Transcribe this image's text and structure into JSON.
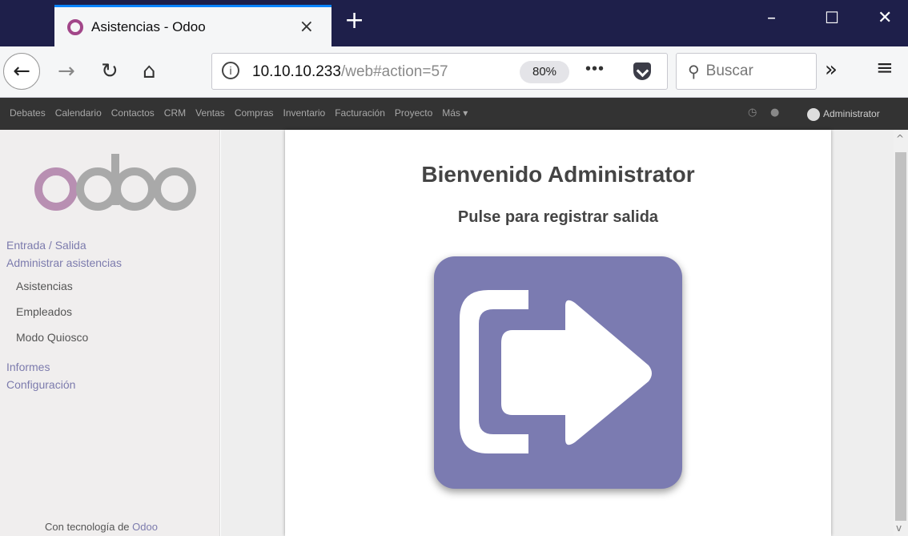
{
  "browser": {
    "tab_title": "Asistencias - Odoo",
    "tab_close": "×",
    "new_tab": "+",
    "window_controls": {
      "minimize": "–",
      "maximize": "☐",
      "close": "✕"
    },
    "nav": {
      "back": "←",
      "forward": "→",
      "reload": "↻",
      "home": "⌂"
    },
    "url_host": "10.10.10.233",
    "url_path": "/web#action=57",
    "zoom": "80%",
    "more_actions": "•••",
    "search_placeholder": "Buscar",
    "overflow": "»",
    "menu": "≡"
  },
  "odoo_topbar": {
    "apps": [
      "Debates",
      "Calendario",
      "Contactos",
      "CRM",
      "Ventas",
      "Compras",
      "Inventario",
      "Facturación",
      "Proyecto",
      "Más ▾"
    ],
    "user": "Administrator",
    "icons": [
      "clock-icon",
      "chat-icon"
    ]
  },
  "sidebar": {
    "logo_text": "odoo",
    "sections": [
      {
        "label": "Entrada / Salida"
      },
      {
        "label": "Administrar asistencias"
      }
    ],
    "items": [
      {
        "label": "Asistencias"
      },
      {
        "label": "Empleados"
      },
      {
        "label": "Modo Quiosco"
      }
    ],
    "sections_bottom": [
      {
        "label": "Informes"
      },
      {
        "label": "Configuración"
      }
    ],
    "powered_prefix": "Con tecnología de",
    "powered_brand": "Odoo"
  },
  "main": {
    "welcome": "Bienvenido Administrator",
    "subtitle": "Pulse para registrar salida",
    "action_button_icon": "sign-out-icon",
    "accent_color": "#7b7bb1"
  }
}
